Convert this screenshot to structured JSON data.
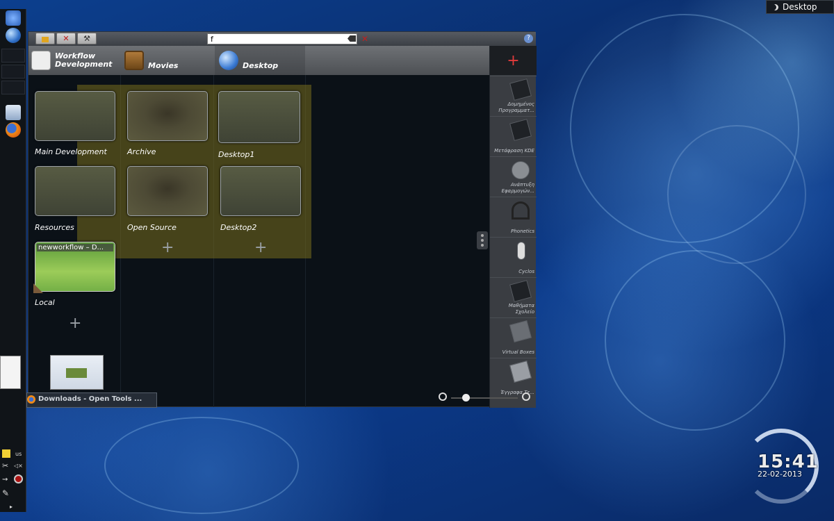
{
  "desktop_label": {
    "text": "Desktop",
    "icon": "moon-icon"
  },
  "toolbar": {
    "search_value": "f",
    "buttons": [
      "lock-icon",
      "close-icon",
      "tools-icon"
    ],
    "help_icon": "help-icon"
  },
  "tabs": [
    {
      "label": "Workflow Development",
      "icon": "cylinder-icon"
    },
    {
      "label": "Movies",
      "icon": "tv-icon"
    },
    {
      "label": "Desktop",
      "icon": "globe-icon"
    }
  ],
  "desktops": [
    {
      "label": "Main Development"
    },
    {
      "label": "Archive"
    },
    {
      "label": "Desktop1"
    },
    {
      "label": "Resources"
    },
    {
      "label": "Open Source"
    },
    {
      "label": "Desktop2"
    },
    {
      "label": "Local",
      "window_title": "newworkflow – D..."
    }
  ],
  "dock": {
    "add_label": "+",
    "items": [
      {
        "label": "Δομημένος Προγραμματ...",
        "icon": "book-icon"
      },
      {
        "label": "Μετάφραση KDE",
        "icon": "flag-icon"
      },
      {
        "label": "Ανάπτυξη Εφαρμογών...",
        "icon": "mp-icon"
      },
      {
        "label": "Phonetics",
        "icon": "headphones-icon"
      },
      {
        "label": "Cyclos",
        "icon": "robot-icon"
      },
      {
        "label": "Μαθήματα Σχολείο",
        "icon": "book-icon"
      },
      {
        "label": "Virtual Boxes",
        "icon": "box-icon"
      },
      {
        "label": "Έγγραφα Τε...",
        "icon": "document-icon"
      }
    ]
  },
  "taskbar": {
    "task_title": "Downloads - Open Tools ..."
  },
  "tray": {
    "keyboard_layout": "us"
  },
  "clock": {
    "time": "15:41",
    "date": "22-02-2013"
  },
  "colors": {
    "accent_red": "#e23b3b",
    "window_bg": "#0b1117",
    "yellow_highlight": "#786e1e"
  }
}
